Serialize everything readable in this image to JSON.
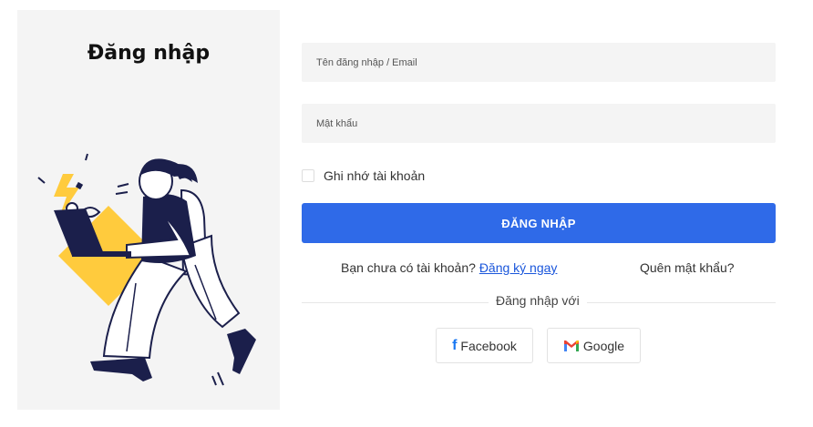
{
  "left": {
    "title": "Đăng nhập"
  },
  "form": {
    "username_placeholder": "Tên đăng nhập / Email",
    "username_value": "",
    "password_placeholder": "Mật khẩu",
    "password_value": "",
    "remember_label": "Ghi nhớ tài khoản",
    "remember_checked": false,
    "submit_label": "ĐĂNG NHẬP",
    "no_account_text": "Bạn chưa có tài khoản? ",
    "register_link": "Đăng ký ngay",
    "forgot_link": "Quên mật khẩu?",
    "divider_text": "Đăng nhập với"
  },
  "social": {
    "facebook_label": "Facebook",
    "google_label": "Google"
  },
  "colors": {
    "primary": "#2f6ae8",
    "panel_bg": "#f4f4f4",
    "link": "#1a56db",
    "accent_yellow": "#ffcb3d",
    "ink_navy": "#1b1f4b"
  },
  "icons": {
    "facebook": "facebook-icon",
    "google": "gmail-icon"
  }
}
